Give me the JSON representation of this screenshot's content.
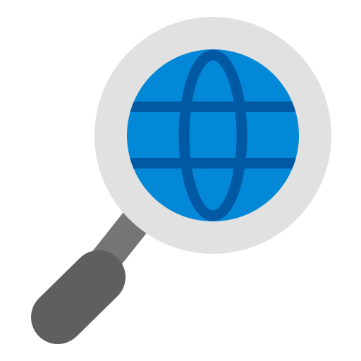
{
  "icon": {
    "name": "web-search-icon",
    "parts": {
      "lens_rim": "magnifier-rim",
      "globe": "globe-icon",
      "handle": "magnifier-handle"
    }
  },
  "colors": {
    "background": "#ffffff",
    "rim": "#e1e1e1",
    "globe_fill": "#0288d6",
    "globe_lines": "#0158a3",
    "handle_neck": "#757575",
    "handle_grip": "#5f5f5f"
  }
}
